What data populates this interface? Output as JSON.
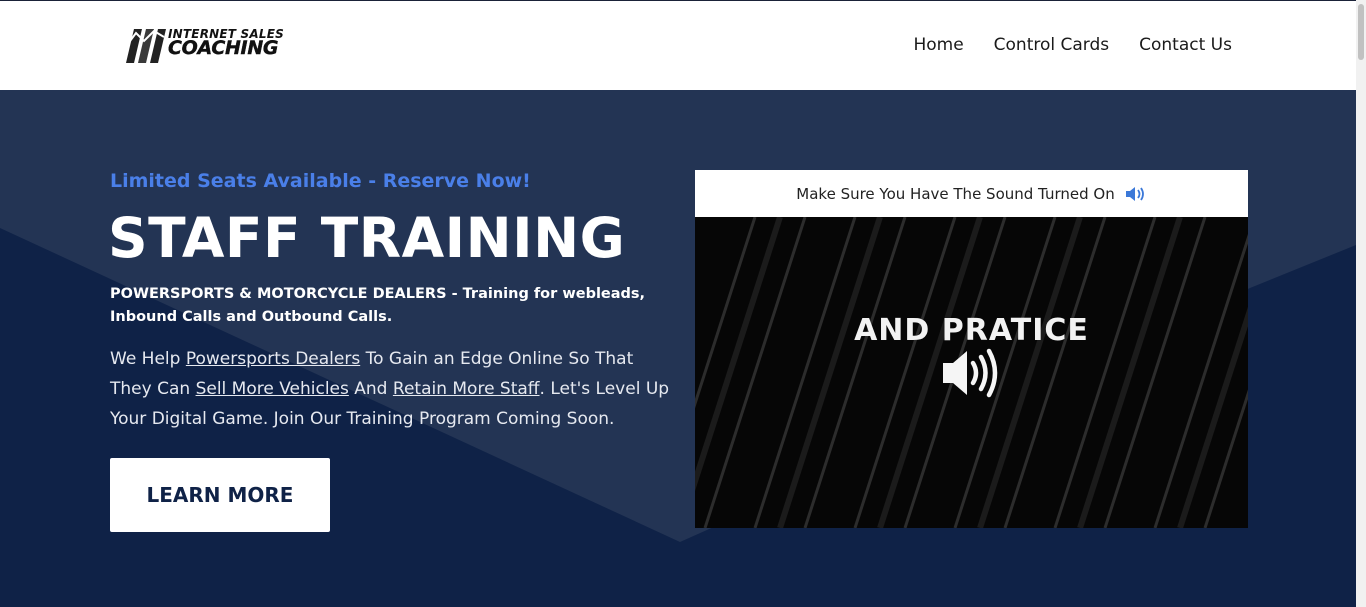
{
  "header": {
    "logo": {
      "line1": "INTERNET SALES",
      "line2": "COACHING"
    },
    "nav": [
      {
        "label": "Home"
      },
      {
        "label": "Control Cards"
      },
      {
        "label": "Contact Us"
      }
    ]
  },
  "hero": {
    "eyebrow": "Limited Seats Available - Reserve Now!",
    "title": "STAFF TRAINING",
    "subtitle": "POWERSPORTS & MOTORCYCLE DEALERS - Training for webleads, Inbound Calls and Outbound Calls.",
    "body": {
      "t1": "We Help ",
      "link1": "Powersports Dealers",
      "t2": " To Gain an Edge Online So That They Can ",
      "link2": "Sell More Vehicles",
      "t3": " And ",
      "link3": "Retain More Staff",
      "t4": ".  Let's Level Up Your Digital Game. Join Our Training Program Coming Soon."
    },
    "cta_label": "LEARN MORE"
  },
  "video": {
    "banner_text": "Make Sure You Have The Sound Turned On",
    "banner_icon": "speaker-icon",
    "caption": "AND PRATICE",
    "center_icon": "volume-icon"
  },
  "colors": {
    "hero_bg": "#0f2247",
    "hero_panel": "#233454",
    "accent": "#4a7fe8",
    "nav_text": "#1a1a1a"
  }
}
